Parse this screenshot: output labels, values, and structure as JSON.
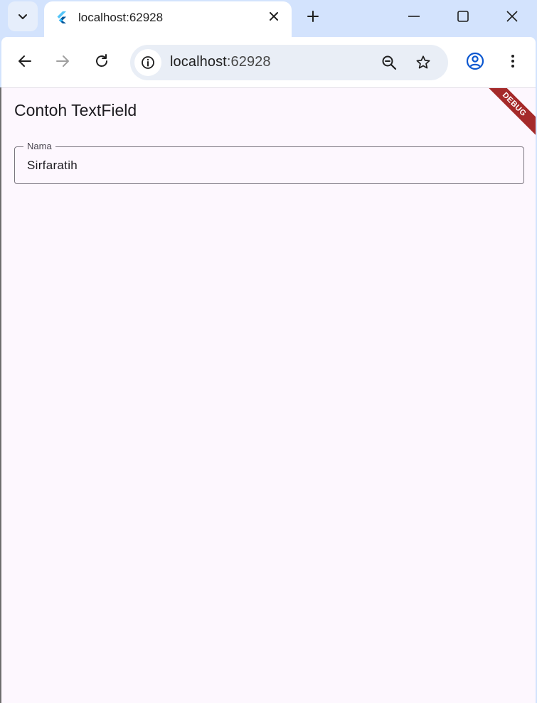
{
  "browser": {
    "tab": {
      "title": "localhost:62928"
    },
    "omnibox": {
      "host": "localhost",
      "port": ":62928"
    }
  },
  "app": {
    "title": "Contoh TextField",
    "text_field": {
      "label": "Nama",
      "value": "Sirfaratih"
    },
    "debug_banner": "DEBUG"
  },
  "colors": {
    "tab_strip": "#d3e3fd",
    "page_background": "#fdf7fe",
    "debug_banner": "#a52a2a",
    "outline": "#79747e"
  }
}
